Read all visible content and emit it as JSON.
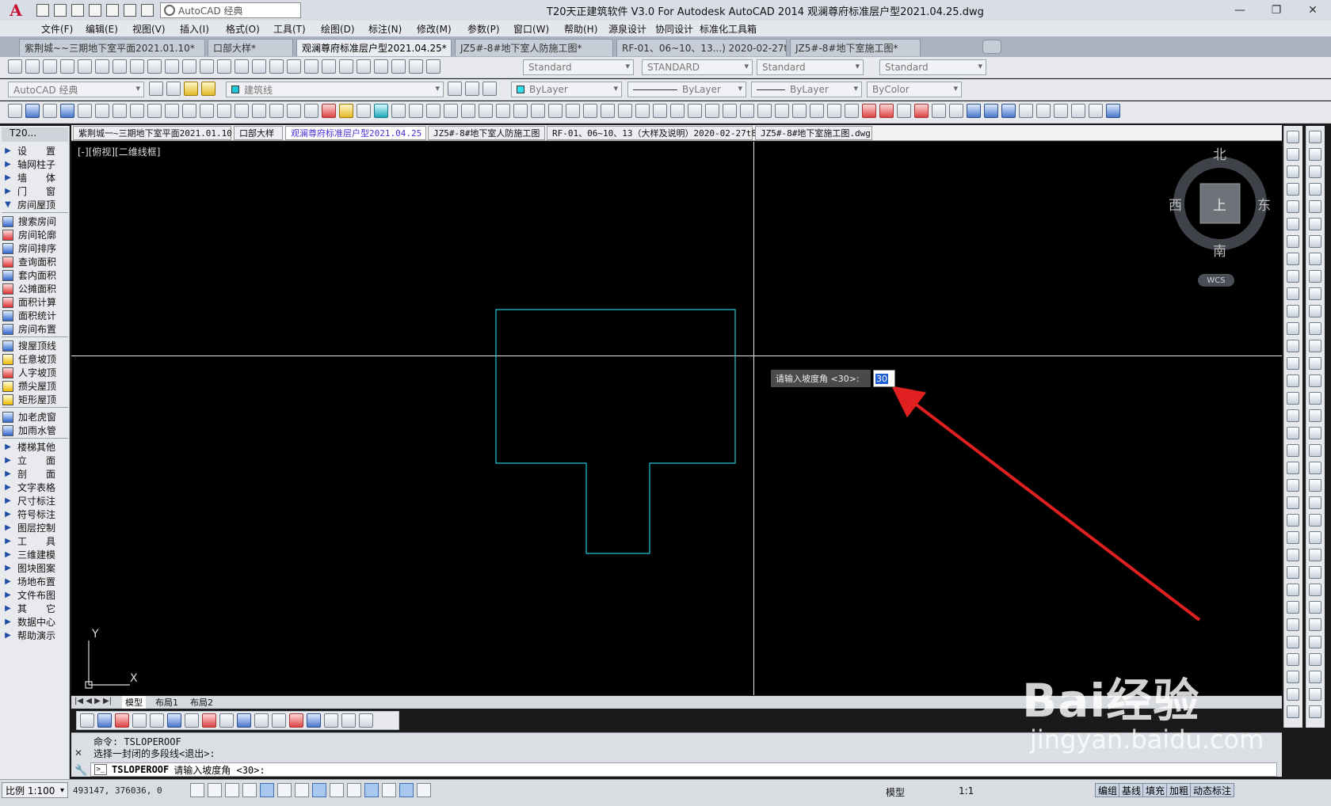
{
  "app": {
    "logo": "A",
    "title": "T20天正建筑软件 V3.0 For Autodesk AutoCAD 2014    观澜尊府标准层户型2021.04.25.dwg",
    "workspace": "AutoCAD 经典"
  },
  "menu": [
    "文件(F)",
    "编辑(E)",
    "视图(V)",
    "插入(I)",
    "格式(O)",
    "工具(T)",
    "绘图(D)",
    "标注(N)",
    "修改(M)",
    "参数(P)",
    "窗口(W)",
    "帮助(H)",
    "源泉设计",
    "协同设计",
    "标准化工具箱"
  ],
  "doc_tabs": [
    {
      "label": "紫荆城~~三期地下室平面2021.01.10*",
      "active": false
    },
    {
      "label": "口部大样*",
      "active": false
    },
    {
      "label": "观澜尊府标准层户型2021.04.25*",
      "active": true
    },
    {
      "label": "JZ5#-8#地下室人防施工图*",
      "active": false
    },
    {
      "label": "RF-01、06~10、13...) 2020-02-27t8*",
      "active": false
    },
    {
      "label": "JZ5#-8#地下室施工图*",
      "active": false
    }
  ],
  "styles": {
    "text_style": "Standard",
    "dim_style": "STANDARD",
    "table_style": "Standard",
    "mleader_style": "Standard"
  },
  "layers": {
    "workspace2": "AutoCAD 经典",
    "current_layer": "建筑线",
    "color": "ByLayer",
    "linetype": "ByLayer",
    "lineweight": "ByLayer",
    "plotstyle": "ByColor"
  },
  "left_panel": {
    "title": "T20...",
    "groups": [
      {
        "label": "设　　置"
      },
      {
        "label": "轴网柱子"
      },
      {
        "label": "墙　　体"
      },
      {
        "label": "门　　窗"
      },
      {
        "label": "房间屋顶"
      }
    ],
    "room_items": [
      "搜索房间",
      "房间轮廓",
      "房间排序",
      "查询面积",
      "套内面积",
      "公摊面积",
      "面积计算",
      "面积统计",
      "房间布置"
    ],
    "roof_items": [
      "搜屋顶线",
      "任意坡顶",
      "人字坡顶",
      "攒尖屋顶",
      "矩形屋顶"
    ],
    "extra_items": [
      "加老虎窗",
      "加雨水管"
    ],
    "more_groups": [
      "楼梯其他",
      "立　　面",
      "剖　　面",
      "文字表格",
      "尺寸标注",
      "符号标注",
      "图层控制",
      "工　　具",
      "三维建模",
      "图块图案",
      "场地布置",
      "文件布图",
      "其　　它",
      "数据中心",
      "帮助演示"
    ]
  },
  "file_tabs": [
    {
      "label": "紫荆城一~三期地下室平面2021.01.10",
      "active": false
    },
    {
      "label": "口部大样",
      "active": false
    },
    {
      "label": "观澜尊府标准层户型2021.04.25",
      "active": true
    },
    {
      "label": "JZ5#-8#地下室人防施工图",
      "active": false
    },
    {
      "label": "RF-01、06~10、13（大样及说明）2020-02-27t8",
      "active": false
    },
    {
      "label": "JZ5#-8#地下室施工图.dwg",
      "active": false
    }
  ],
  "canvas": {
    "view_label": "[-][俯视][二维线框]",
    "compass": {
      "north": "北",
      "south": "南",
      "east": "东",
      "west": "西",
      "center": "上"
    },
    "wcs": "WCS",
    "dyn_prompt": "请输入坡度角 <30>:",
    "dyn_value": "30",
    "ucs_x": "X",
    "ucs_y": "Y",
    "outline_color": "#22c7d6",
    "arrow_color": "#e02020"
  },
  "layout_tabs": [
    {
      "label": "模型",
      "active": true
    },
    {
      "label": "布局1",
      "active": false
    },
    {
      "label": "布局2",
      "active": false
    }
  ],
  "command": {
    "line1": "命令:  TSLOPEROOF",
    "line2": "选择一封闭的多段线<退出>:",
    "current_cmd": "TSLOPEROOF",
    "current_prompt": "请输入坡度角 <30>:"
  },
  "status": {
    "scale": "比例 1:100",
    "coords": "493147, 376036, 0",
    "model": "模型",
    "annoscale": "1:1",
    "buttons": [
      "编组",
      "基线",
      "填充",
      "加粗",
      "动态标注"
    ]
  },
  "watermark": {
    "brand": "Bai经验",
    "url": "jingyan.baidu.com"
  }
}
